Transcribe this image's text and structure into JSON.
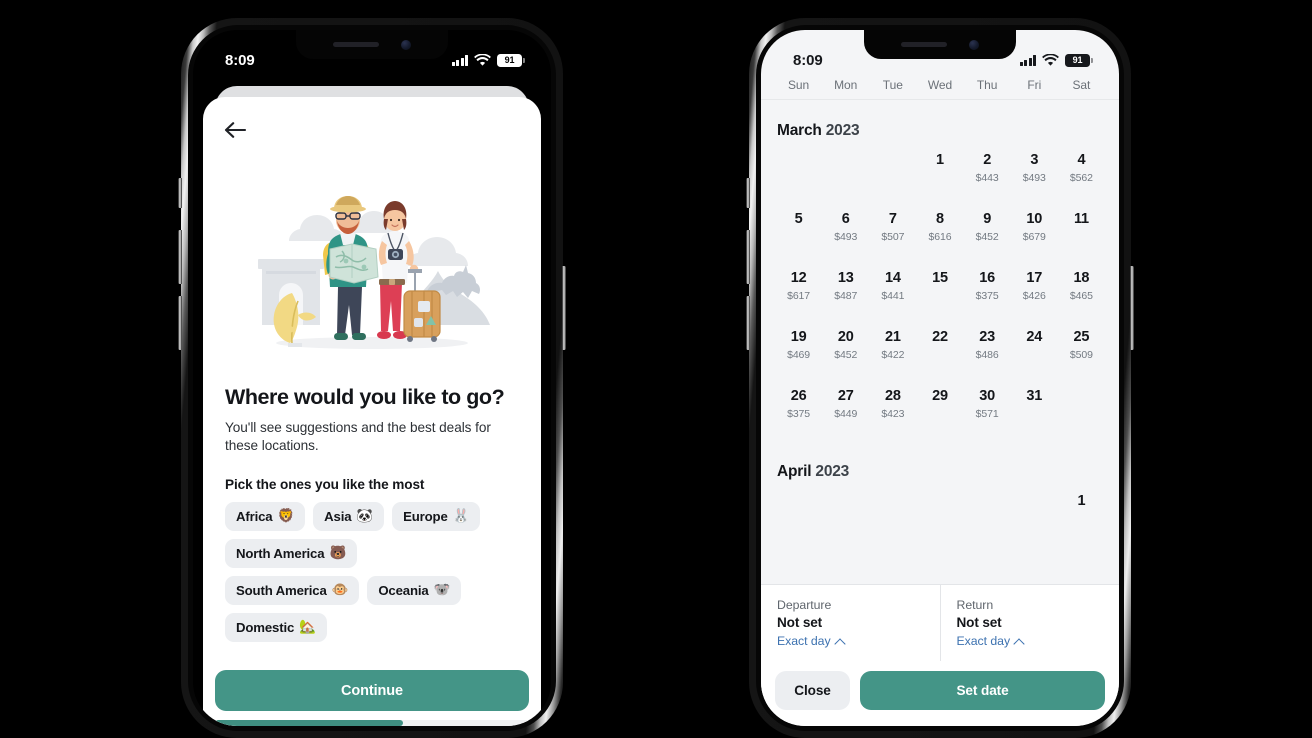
{
  "screen": {
    "background_color": "#000000",
    "accent_green": "#449587",
    "link_blue": "#3d72b0"
  },
  "left_phone": {
    "status_bar": {
      "time": "8:09",
      "battery": "91",
      "signal_icon": "cellular-signal-icon",
      "wifi_icon": "wifi-icon",
      "battery_icon": "battery-icon"
    },
    "back_icon": "back-arrow-icon",
    "illustration": "travel-couple-illustration",
    "heading": "Where would you like to go?",
    "subtext": "You'll see suggestions and the best deals for these locations.",
    "pick_label": "Pick the ones you like the most",
    "chips": [
      {
        "label": "Africa",
        "emoji": "🦁"
      },
      {
        "label": "Asia",
        "emoji": "🐼"
      },
      {
        "label": "Europe",
        "emoji": "🐰"
      },
      {
        "label": "North America",
        "emoji": "🐻"
      },
      {
        "label": "South America",
        "emoji": "🐵"
      },
      {
        "label": "Oceania",
        "emoji": "🐨"
      },
      {
        "label": "Domestic",
        "emoji": "🏡"
      }
    ],
    "continue_label": "Continue",
    "progress_percent": 60
  },
  "right_phone": {
    "status_bar": {
      "time": "8:09",
      "battery": "91",
      "signal_icon": "cellular-signal-icon",
      "wifi_icon": "wifi-icon",
      "battery_icon": "battery-icon"
    },
    "weekdays": [
      "Sun",
      "Mon",
      "Tue",
      "Wed",
      "Thu",
      "Fri",
      "Sat"
    ],
    "months": [
      {
        "name": "March",
        "year": "2023",
        "lead_blanks": 3,
        "days": [
          {
            "day": "1",
            "price": ""
          },
          {
            "day": "2",
            "price": "$443"
          },
          {
            "day": "3",
            "price": "$493"
          },
          {
            "day": "4",
            "price": "$562"
          },
          {
            "day": "5",
            "price": ""
          },
          {
            "day": "6",
            "price": "$493"
          },
          {
            "day": "7",
            "price": "$507"
          },
          {
            "day": "8",
            "price": "$616"
          },
          {
            "day": "9",
            "price": "$452"
          },
          {
            "day": "10",
            "price": "$679"
          },
          {
            "day": "11",
            "price": ""
          },
          {
            "day": "12",
            "price": "$617"
          },
          {
            "day": "13",
            "price": "$487"
          },
          {
            "day": "14",
            "price": "$441"
          },
          {
            "day": "15",
            "price": ""
          },
          {
            "day": "16",
            "price": "$375"
          },
          {
            "day": "17",
            "price": "$426"
          },
          {
            "day": "18",
            "price": "$465"
          },
          {
            "day": "19",
            "price": "$469"
          },
          {
            "day": "20",
            "price": "$452"
          },
          {
            "day": "21",
            "price": "$422"
          },
          {
            "day": "22",
            "price": ""
          },
          {
            "day": "23",
            "price": "$486"
          },
          {
            "day": "24",
            "price": ""
          },
          {
            "day": "25",
            "price": "$509"
          },
          {
            "day": "26",
            "price": "$375"
          },
          {
            "day": "27",
            "price": "$449"
          },
          {
            "day": "28",
            "price": "$423"
          },
          {
            "day": "29",
            "price": ""
          },
          {
            "day": "30",
            "price": "$571"
          },
          {
            "day": "31",
            "price": ""
          }
        ]
      },
      {
        "name": "April",
        "year": "2023",
        "lead_blanks": 6,
        "days": [
          {
            "day": "1",
            "price": ""
          }
        ]
      }
    ],
    "departure": {
      "label": "Departure",
      "value": "Not set",
      "link": "Exact day",
      "chevron_icon": "chevron-up-icon"
    },
    "return": {
      "label": "Return",
      "value": "Not set",
      "link": "Exact day",
      "chevron_icon": "chevron-up-icon"
    },
    "close_label": "Close",
    "set_date_label": "Set date"
  }
}
